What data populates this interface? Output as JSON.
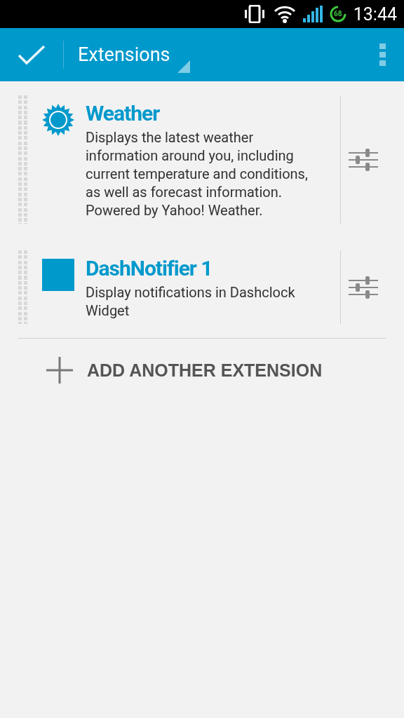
{
  "status_bar": {
    "battery": "68",
    "time": "13:44"
  },
  "action_bar": {
    "title": "Extensions"
  },
  "extensions": [
    {
      "kind": "weather",
      "title": "Weather",
      "description": "Displays the latest weather information around you, including current temperature and conditions, as well as forecast information. Powered by Yahoo! Weather."
    },
    {
      "kind": "square",
      "title": "DashNotifier 1",
      "description": "Display notifications in Dashclock Widget"
    }
  ],
  "add_button": {
    "label": "ADD ANOTHER EXTENSION"
  }
}
